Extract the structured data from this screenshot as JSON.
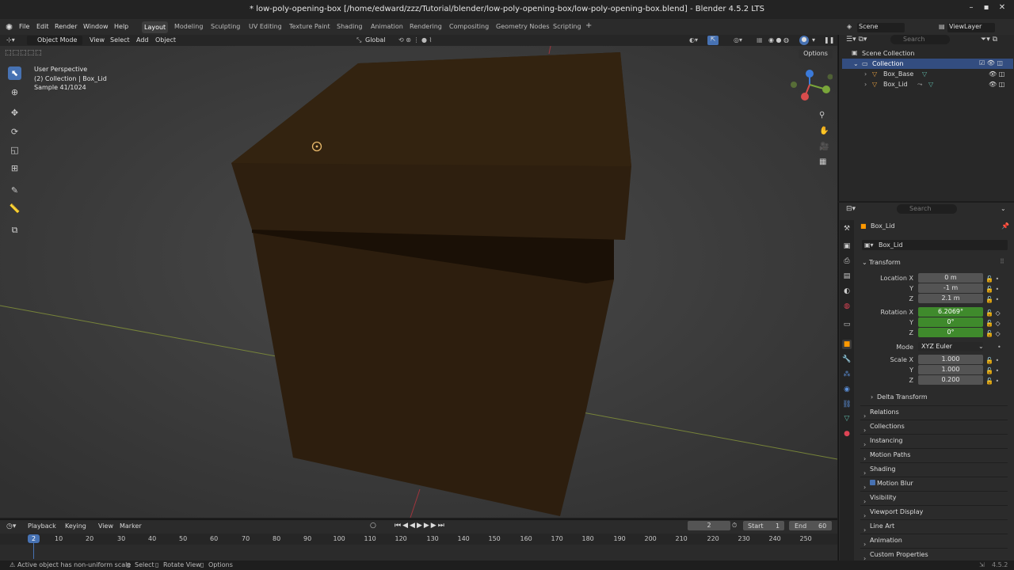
{
  "window": {
    "title": "* low-poly-opening-box [/home/edward/zzz/Tutorial/blender/low-poly-opening-box/low-poly-opening-box.blend] - Blender 4.5.2 LTS",
    "min": "–",
    "max": "▪",
    "close": "✕"
  },
  "menu": [
    "File",
    "Edit",
    "Render",
    "Window",
    "Help"
  ],
  "workspaces": [
    "Layout",
    "Modeling",
    "Sculpting",
    "UV Editing",
    "Texture Paint",
    "Shading",
    "Animation",
    "Rendering",
    "Compositing",
    "Geometry Nodes",
    "Scripting"
  ],
  "active_workspace": "Layout",
  "scene": {
    "label": "Scene",
    "viewlayer": "ViewLayer"
  },
  "viewport_header": {
    "mode": "Object Mode",
    "items": [
      "View",
      "Select",
      "Add",
      "Object"
    ],
    "orientation": "Global",
    "options": "Options"
  },
  "viewport_overlay": {
    "line1": "User Perspective",
    "line2": "(2) Collection | Box_Lid",
    "line3": "Sample 41/1024"
  },
  "outliner": {
    "search_placeholder": "Search",
    "root": "Scene Collection",
    "collection": "Collection",
    "items": [
      "Box_Base",
      "Box_Lid"
    ]
  },
  "properties": {
    "search_placeholder": "Search",
    "object_name": "Box_Lid",
    "datablock": "Box_Lid",
    "transform_label": "Transform",
    "location": {
      "label": "Location X",
      "x": "0 m",
      "y_label": "Y",
      "y": "-1 m",
      "z_label": "Z",
      "z": "2.1 m"
    },
    "rotation": {
      "label": "Rotation X",
      "x": "6.2069°",
      "y_label": "Y",
      "y": "0°",
      "z_label": "Z",
      "z": "0°"
    },
    "mode": {
      "label": "Mode",
      "value": "XYZ Euler"
    },
    "scale": {
      "label": "Scale X",
      "x": "1.000",
      "y_label": "Y",
      "y": "1.000",
      "z_label": "Z",
      "z": "0.200"
    },
    "delta": "Delta Transform",
    "panels": [
      "Relations",
      "Collections",
      "Instancing",
      "Motion Paths",
      "Shading",
      "Motion Blur",
      "Visibility",
      "Viewport Display",
      "Line Art",
      "Animation",
      "Custom Properties"
    ]
  },
  "timeline": {
    "menus": [
      "Playback",
      "Keying",
      "View",
      "Marker"
    ],
    "current_frame": "2",
    "start_label": "Start",
    "start": "1",
    "end_label": "End",
    "end": "60",
    "ticks": [
      "10",
      "20",
      "30",
      "40",
      "50",
      "60",
      "70",
      "80",
      "90",
      "100",
      "110",
      "120",
      "130",
      "140",
      "150",
      "160",
      "170",
      "180",
      "190",
      "200",
      "210",
      "220",
      "230",
      "240",
      "250"
    ],
    "cursor": "2"
  },
  "status": {
    "message": "Active object has non-uniform scale",
    "select": "Select",
    "rotate": "Rotate View",
    "options": "Options",
    "version": "4.5.2"
  },
  "colors": {
    "accent": "#4772b3",
    "animated": "#3f8a2c",
    "box": "#2e1f10"
  }
}
